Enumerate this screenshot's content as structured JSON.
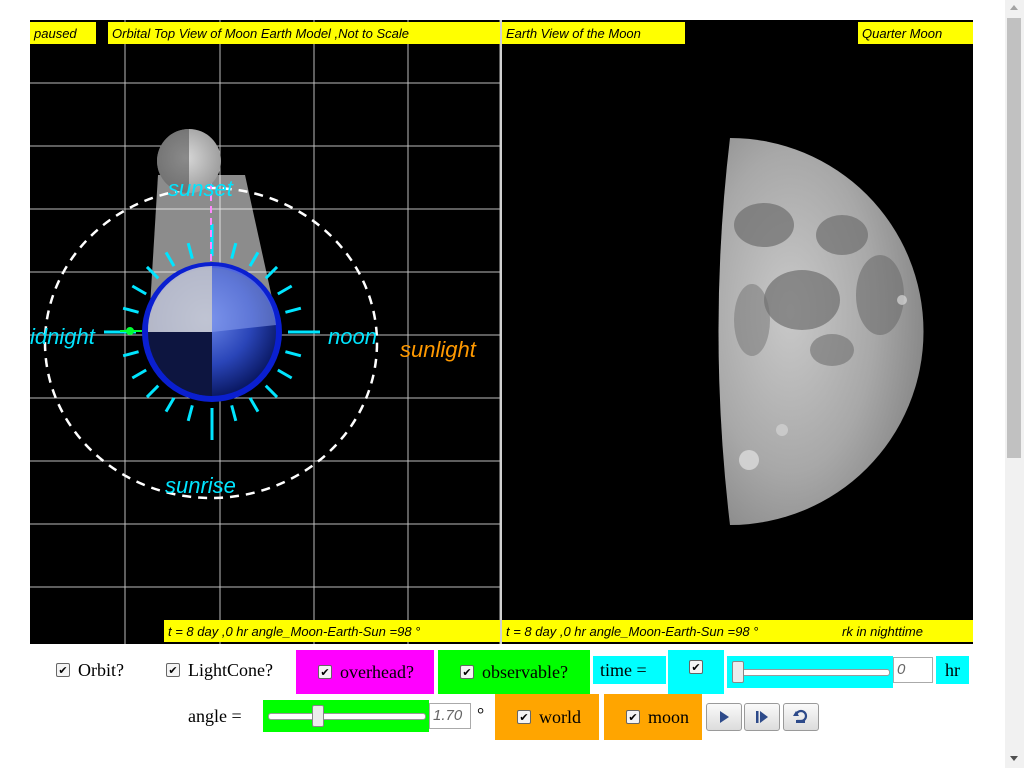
{
  "left_panel": {
    "status": "paused",
    "title": "Orbital Top View of Moon Earth Model ,Not to Scale",
    "footer": "t = 8 day ,0 hr angle_Moon-Earth-Sun =98 °",
    "labels": {
      "sunset": "sunset",
      "sunrise": "sunrise",
      "noon": "noon",
      "midnight": "idnight",
      "sunlight": "sunlight"
    }
  },
  "right_panel": {
    "title": "Earth View of the Moon",
    "phase": "Quarter Moon",
    "footer": "t = 8 day ,0 hr angle_Moon-Earth-Sun =98 °",
    "footer2": "rk in nighttime"
  },
  "controls": {
    "orbit_label": "Orbit?",
    "lightcone_label": "LightCone?",
    "overhead_label": "overhead?",
    "observable_label": "observable?",
    "time_label": "time =",
    "time_value": "0",
    "time_unit": "hr",
    "angle_label": "angle =",
    "angle_value": "1.70",
    "angle_unit": "°",
    "world_label": "world",
    "moon_label": "moon",
    "check": "✔",
    "time_slider_fraction": 0.0,
    "angle_slider_fraction": 0.3
  },
  "colors": {
    "label_bg": "#ffff00",
    "overhead_bg": "#ff00ff",
    "observable_bg": "#00ff00",
    "time_bg": "#00ffff",
    "world_bg": "#ffa500",
    "cyan_text": "#00e5ff",
    "sunlight_text": "#ff9900"
  }
}
